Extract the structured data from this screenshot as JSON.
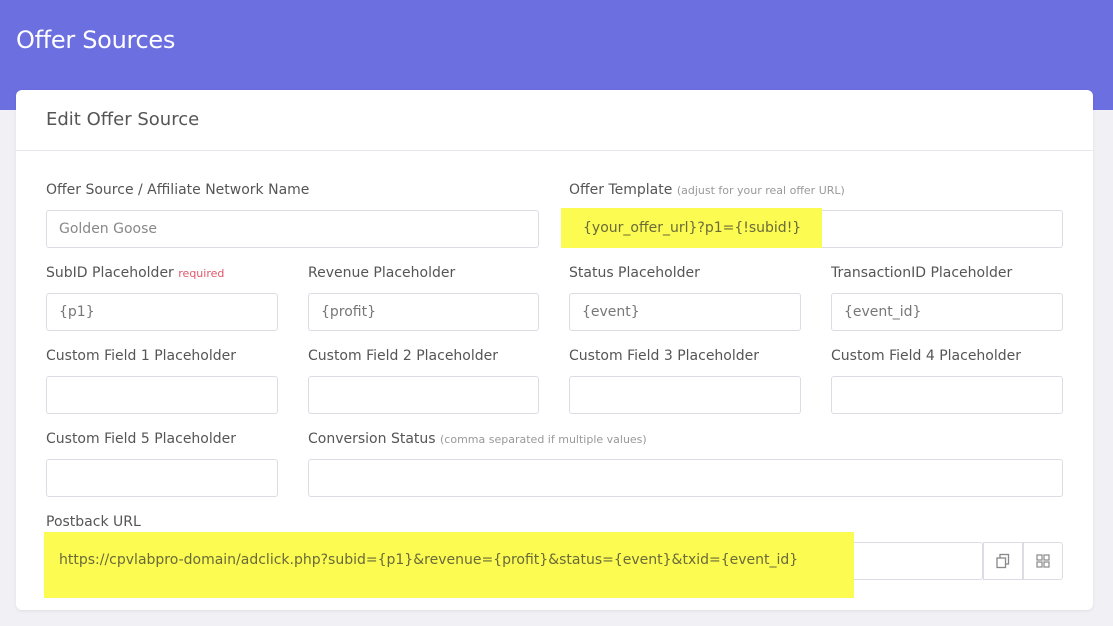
{
  "page": {
    "title": "Offer Sources"
  },
  "card": {
    "title": "Edit Offer Source"
  },
  "form": {
    "network_name": {
      "label": "Offer Source / Affiliate Network Name",
      "placeholder": "Golden Goose"
    },
    "offer_template": {
      "label": "Offer Template",
      "hint": "(adjust for your real offer URL)",
      "value": "{your_offer_url}?p1={!subid!}"
    },
    "subid": {
      "label": "SubID Placeholder",
      "required": "required",
      "value": "{p1}"
    },
    "revenue": {
      "label": "Revenue Placeholder",
      "value": "{profit}"
    },
    "status": {
      "label": "Status Placeholder",
      "value": "{event}"
    },
    "transaction_id": {
      "label": "TransactionID Placeholder",
      "value": "{event_id}"
    },
    "custom1": {
      "label": "Custom Field 1 Placeholder",
      "value": ""
    },
    "custom2": {
      "label": "Custom Field 2 Placeholder",
      "value": ""
    },
    "custom3": {
      "label": "Custom Field 3 Placeholder",
      "value": ""
    },
    "custom4": {
      "label": "Custom Field 4 Placeholder",
      "value": ""
    },
    "custom5": {
      "label": "Custom Field 5 Placeholder",
      "value": ""
    },
    "conversion_status": {
      "label": "Conversion Status",
      "hint": "(comma separated if multiple values)",
      "value": ""
    },
    "postback": {
      "label": "Postback URL",
      "value": "https://cpvlabpro-domain/adclick.php?subid={p1}&revenue={profit}&status={event}&txid={event_id}"
    }
  },
  "icons": {
    "copy": "copy-icon",
    "qr": "qr-grid-icon"
  },
  "colors": {
    "header": "#6c6fe0",
    "highlight": "#fbfb52",
    "required": "#e0566b"
  }
}
